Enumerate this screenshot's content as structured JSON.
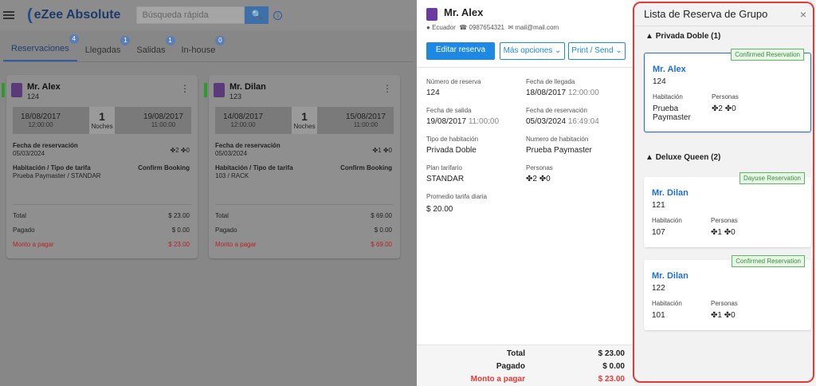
{
  "app": {
    "logo": "eZee Absolute",
    "search_placeholder": "Búsqueda rápida",
    "info_icon": "i"
  },
  "tabs": [
    {
      "label": "Reservaciones",
      "count": "4"
    },
    {
      "label": "Llegadas",
      "count": "1"
    },
    {
      "label": "Salidas",
      "count": "1"
    },
    {
      "label": "In-house",
      "count": "0"
    }
  ],
  "cards": [
    {
      "name": "Mr. Alex",
      "room": "124",
      "checkin": "18/08/2017",
      "checkin_time": "12:00:00",
      "nights": "1",
      "nights_label": "Noches",
      "checkout": "19/08/2017",
      "checkout_time": "11:00:00",
      "res_date_label": "Fecha de reservación",
      "res_date": "05/03/2024",
      "adults": "2",
      "children": "0",
      "room_rate_label": "Habitación / Tipo de tarifa",
      "room_rate": "Prueba Paymaster / STANDAR",
      "booking": "Confirm Booking",
      "total_label": "Total",
      "total": "$ 23.00",
      "paid_label": "Pagado",
      "paid": "$ 0.00",
      "due_label": "Monto a pagar",
      "due": "$ 23.00"
    },
    {
      "name": "Mr. Dilan",
      "room": "123",
      "checkin": "14/08/2017",
      "checkin_time": "12:00:00",
      "nights": "1",
      "nights_label": "Noches",
      "checkout": "15/08/2017",
      "checkout_time": "11:00:00",
      "res_date_label": "Fecha de reservación",
      "res_date": "05/03/2024",
      "adults": "1",
      "children": "0",
      "room_rate_label": "Habitación / Tipo de tarifa",
      "room_rate": "103 / RACK",
      "booking": "Confirm Booking",
      "total_label": "Total",
      "total": "$ 69.00",
      "paid_label": "Pagado",
      "paid": "$ 0.00",
      "due_label": "Monto a pagar",
      "due": "$ 69.00"
    }
  ],
  "detail": {
    "name": "Mr. Alex",
    "country": "Ecuador",
    "phone": "0987654321",
    "email": "mail@mail.com",
    "edit_btn": "Editar reserva",
    "more_btn": "Más opciones",
    "print_btn": "Print / Send",
    "f1l": "Número de reserva",
    "f1v": "124",
    "f2l": "Fecha de llegada",
    "f2v": "18/08/2017",
    "f2t": "12:00:00",
    "f3l": "Fecha de salida",
    "f3v": "19/08/2017",
    "f3t": "11:00:00",
    "f4l": "Fecha de reservación",
    "f4v": "05/03/2024",
    "f4t": "16:49:04",
    "f5l": "Tipo de habitación",
    "f5v": "Privada Doble",
    "f6l": "Numero de habitación",
    "f6v": "Prueba Paymaster",
    "f7l": "Plan tarifario",
    "f7v": "STANDAR",
    "f8l": "Personas",
    "f8a": "2",
    "f8c": "0",
    "f9l": "Promedio tarifa diaria",
    "f9v": "$ 20.00",
    "total_label": "Total",
    "total": "$ 23.00",
    "paid_label": "Pagado",
    "paid": "$ 0.00",
    "due_label": "Monto a pagar",
    "due": "$ 23.00"
  },
  "group": {
    "title": "Lista de Reserva de Grupo",
    "close": "×",
    "sections": [
      {
        "header": "Privada Doble (1)",
        "items": [
          {
            "tag": "Confirmed Reservation",
            "name": "Mr. Alex",
            "num": "124",
            "room_label": "Habitación",
            "room": "Prueba Paymaster",
            "persons_label": "Personas",
            "adults": "2",
            "children": "0"
          }
        ]
      },
      {
        "header": "Deluxe Queen (2)",
        "items": [
          {
            "tag": "Dayuse Reservation",
            "name": "Mr. Dilan",
            "num": "121",
            "room_label": "Habitación",
            "room": "107",
            "persons_label": "Personas",
            "adults": "1",
            "children": "0"
          },
          {
            "tag": "Confirmed Reservation",
            "name": "Mr. Dilan",
            "num": "122",
            "room_label": "Habitación",
            "room": "101",
            "persons_label": "Personas",
            "adults": "1",
            "children": "0"
          }
        ]
      }
    ]
  }
}
